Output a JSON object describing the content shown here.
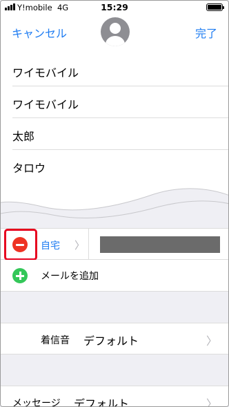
{
  "status_bar": {
    "carrier": "Y!mobile",
    "network": "4G",
    "time": "15:29"
  },
  "nav": {
    "cancel_label": "キャンセル",
    "done_label": "完了"
  },
  "names": [
    "ワイモバイル",
    "ワイモバイル",
    "太郎",
    "タロウ"
  ],
  "phone": {
    "label": "自宅",
    "chevron": "〉"
  },
  "mail": {
    "add_label": "メールを追加"
  },
  "ringtone": {
    "label": "着信音",
    "value": "デフォルト",
    "chevron": "〉"
  },
  "message": {
    "label": "メッセージ",
    "value": "デフォルト",
    "chevron": "〉"
  },
  "colors": {
    "accent": "#1e7cf2",
    "delete": "#ee3324",
    "add": "#34c759",
    "highlight": "#e6001e"
  }
}
